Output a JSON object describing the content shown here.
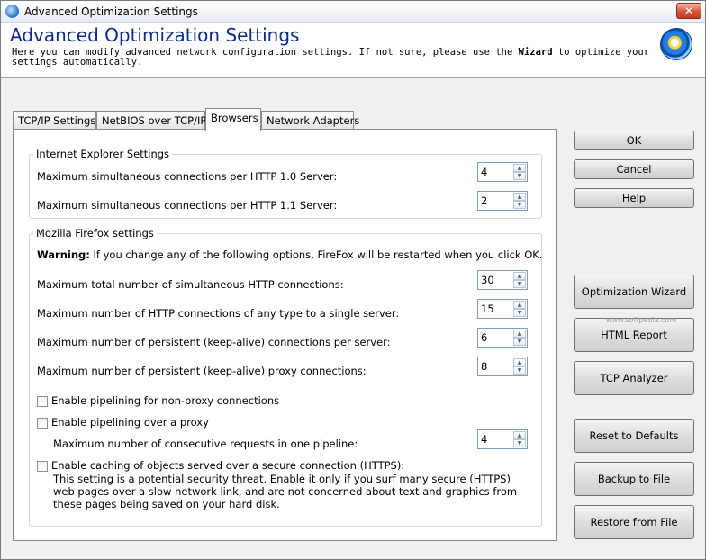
{
  "window": {
    "title": "Advanced Optimization Settings",
    "close_glyph": "✕"
  },
  "header": {
    "title": "Advanced Optimization Settings",
    "desc_before": "Here you can modify advanced network configuration settings. If not sure, please use the ",
    "desc_bold": "Wizard",
    "desc_after": " to optimize your settings automatically."
  },
  "tabs": [
    {
      "label": "TCP/IP Settings"
    },
    {
      "label": "NetBIOS over TCP/IP"
    },
    {
      "label": "Browsers"
    },
    {
      "label": "Network Adapters"
    }
  ],
  "ie": {
    "group_label": "Internet Explorer Settings",
    "rows": [
      {
        "label": "Maximum simultaneous connections per HTTP 1.0 Server:",
        "value": "4"
      },
      {
        "label": "Maximum simultaneous connections per HTTP 1.1 Server:",
        "value": "2"
      }
    ]
  },
  "firefox": {
    "group_label": "Mozilla Firefox settings",
    "warning_bold": "Warning:",
    "warning_text": " If you change any of the following options, FireFox will be restarted when you click OK.",
    "rows": [
      {
        "label": "Maximum total number of simultaneous HTTP connections:",
        "value": "30"
      },
      {
        "label": "Maximum number of HTTP connections of any type to a single server:",
        "value": "15"
      },
      {
        "label": "Maximum number of persistent (keep-alive) connections per server:",
        "value": "6"
      },
      {
        "label": "Maximum number of persistent (keep-alive) proxy connections:",
        "value": "8"
      }
    ],
    "check_pipelining": "Enable pipelining for non-proxy connections",
    "check_pipelining_proxy": "Enable pipelining over a proxy",
    "pipeline_label": "Maximum number of consecutive requests in one pipeline:",
    "pipeline_value": "4",
    "check_https": "Enable caching of objects served over a secure connection (HTTPS):",
    "https_note": "This setting is a potential security threat. Enable it only if you surf many secure (HTTPS) web pages over a slow network link, and are not concerned about text and graphics from these pages being saved on your hard disk."
  },
  "buttons": {
    "ok": "OK",
    "cancel": "Cancel",
    "help": "Help",
    "wizard": "Optimization Wizard",
    "html_report": "HTML Report",
    "tcp_analyzer": "TCP Analyzer",
    "reset": "Reset to Defaults",
    "backup": "Backup to File",
    "restore": "Restore from File"
  },
  "spin_up": "▲",
  "spin_down": "▼",
  "watermark": "www.softpedia.com"
}
